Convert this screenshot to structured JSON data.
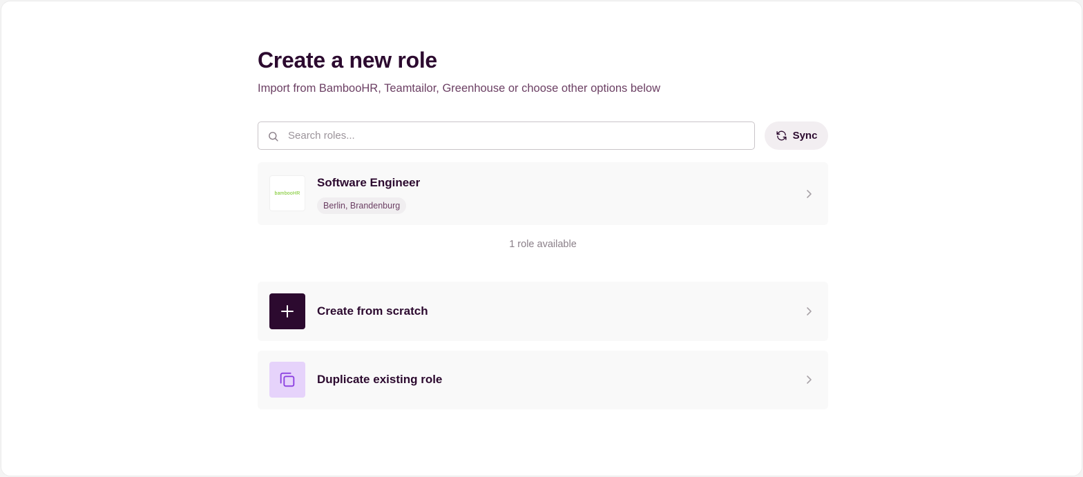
{
  "header": {
    "title": "Create a new role",
    "subtitle": "Import from BambooHR, Teamtailor, Greenhouse or choose other options below"
  },
  "search": {
    "placeholder": "Search roles...",
    "value": ""
  },
  "sync_button": {
    "label": "Sync",
    "icon": "refresh-icon"
  },
  "roles": [
    {
      "title": "Software Engineer",
      "location": "Berlin, Brandenburg",
      "source_logo_text": "bambooHR",
      "icon": "chevron-right-icon"
    }
  ],
  "roles_count_text": "1 role available",
  "options": [
    {
      "label": "Create from scratch",
      "icon": "plus-icon"
    },
    {
      "label": "Duplicate existing role",
      "icon": "copy-icon"
    }
  ],
  "colors": {
    "title": "#2c0a2f",
    "subtitle": "#6b3f63",
    "scratch_icon_bg": "#2c0a2f",
    "duplicate_icon_bg": "#e6d3fb",
    "duplicate_icon": "#8b3fe0",
    "logo_green": "#73c41d"
  }
}
